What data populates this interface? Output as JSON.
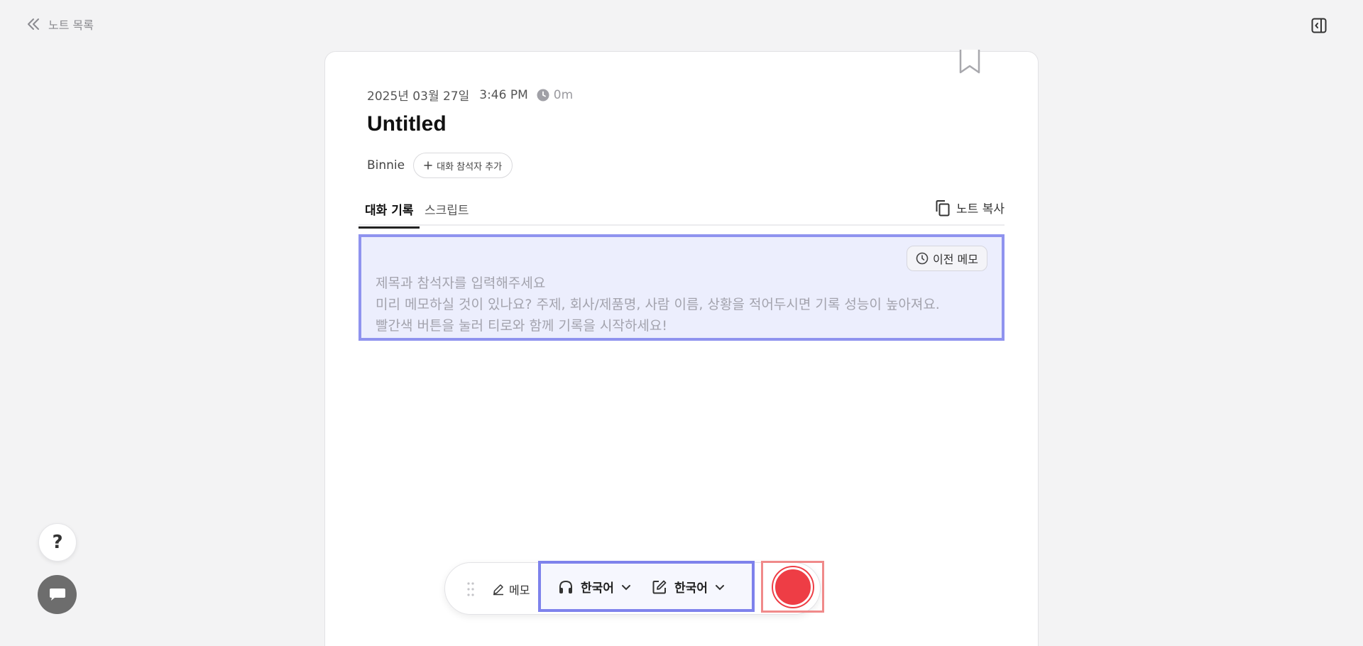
{
  "header": {
    "back_label": "노트 목록",
    "back_icon": "double-chevron-left-icon",
    "panel_icon": "sidebar-toggle-icon"
  },
  "note": {
    "date": "2025년 03월 27일",
    "time": "3:46 PM",
    "duration": "0m",
    "title": "Untitled",
    "participant": "Binnie",
    "add_participant_label": "대화 참석자 추가"
  },
  "tabs": [
    {
      "label": "대화 기록",
      "active": true
    },
    {
      "label": "스크립트",
      "active": false
    }
  ],
  "copy_note_label": "노트 복사",
  "memo": {
    "prev_memo_label": "이전 메모",
    "placeholder_lines": [
      "제목과 참석자를 입력해주세요",
      "미리 메모하실 것이 있나요? 주제, 회사/제품명, 사람 이름, 상황을 적어두시면 기록 성능이 높아져요.",
      "빨간색 버튼을 눌러 티로와 함께 기록을 시작하세요!"
    ]
  },
  "floating": {
    "help_label": "?",
    "chat_icon": "chat-icon"
  },
  "toolbar": {
    "memo_label": "메모",
    "listen_language": "한국어",
    "write_language": "한국어",
    "record_color": "#ee3d45"
  },
  "colors": {
    "accent_highlight": "#8f93ef",
    "record_highlight": "#f08a8a",
    "background": "#f3f3f4"
  }
}
